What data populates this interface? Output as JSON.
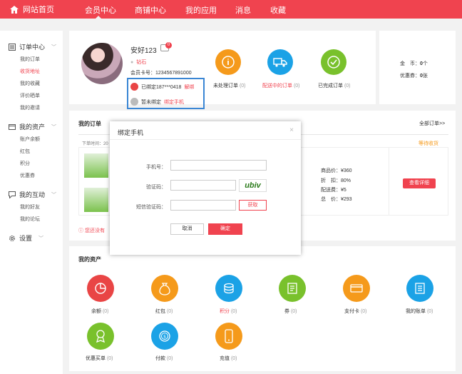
{
  "topnav": {
    "home": "网站首页",
    "items": [
      "会员中心",
      "商铺中心",
      "我的应用",
      "消息",
      "收藏"
    ]
  },
  "sidebar": {
    "sections": [
      {
        "title": "订单中心",
        "items": [
          "我的订单",
          "收货地址",
          "我的收藏",
          "评价晒单",
          "我的邀请"
        ]
      },
      {
        "title": "我的资产",
        "items": [
          "账户余额",
          "红包",
          "积分",
          "优惠券"
        ]
      },
      {
        "title": "我的互动",
        "items": [
          "我的好友",
          "我的论坛"
        ]
      },
      {
        "title": "设置",
        "items": []
      }
    ]
  },
  "profile": {
    "username": "安好123",
    "msg_count": "0",
    "grade": "钻石",
    "card_no": "会员卡号：1234567891000",
    "bound_text": "已绑定187***0418",
    "unbind": "解绑",
    "unbound_text": "暂未绑定",
    "bind_phone": "绑定手机"
  },
  "order_status": [
    {
      "label": "未处理订单",
      "count": "(0)",
      "color": "#f59a1b"
    },
    {
      "label": "配送中的订单",
      "count": "(0)",
      "color": "#1ba2e6"
    },
    {
      "label": "已完成订单",
      "count": "(0)",
      "color": "#79c12c"
    }
  ],
  "balance": {
    "coin_label": "金　币：",
    "coin_value": "0",
    "coin_unit": "个",
    "coupon_label": "优惠券：",
    "coupon_value": "0",
    "coupon_unit": "张"
  },
  "orders": {
    "title": "我的订单",
    "all_link": "全部订单>>",
    "order_time": "下单时间：20",
    "status": "等待收货",
    "summary": [
      "商品价：¥360",
      "折　扣：80%",
      "配送费：¥5",
      "总　价：¥293"
    ],
    "view_btn": "查看详细",
    "notice": "您还没有"
  },
  "dialog": {
    "title": "绑定手机",
    "close": "×",
    "phone_label": "手机号：",
    "code_label": "验证码：",
    "captcha": "ubiv",
    "sms_label": "短信验证码：",
    "get_btn": "获取",
    "cancel": "取消",
    "confirm": "确定"
  },
  "assets": {
    "title": "我的资产",
    "items": [
      {
        "label": "余额",
        "count": "(0)",
        "color": "#e94545"
      },
      {
        "label": "红包",
        "count": "(0)",
        "color": "#f59a1b"
      },
      {
        "label": "积分",
        "count": "(0)",
        "color": "#1ba2e6",
        "red": true
      },
      {
        "label": "券",
        "count": "(0)",
        "color": "#79c12c"
      },
      {
        "label": "支付卡",
        "count": "(0)",
        "color": "#f59a1b"
      },
      {
        "label": "我的账单",
        "count": "(0)",
        "color": "#1ba2e6"
      },
      {
        "label": "优惠买单",
        "count": "(0)",
        "color": "#79c12c"
      },
      {
        "label": "付款",
        "count": "(0)",
        "color": "#1ba2e6"
      },
      {
        "label": "充值",
        "count": "(0)",
        "color": "#f59a1b"
      }
    ]
  }
}
